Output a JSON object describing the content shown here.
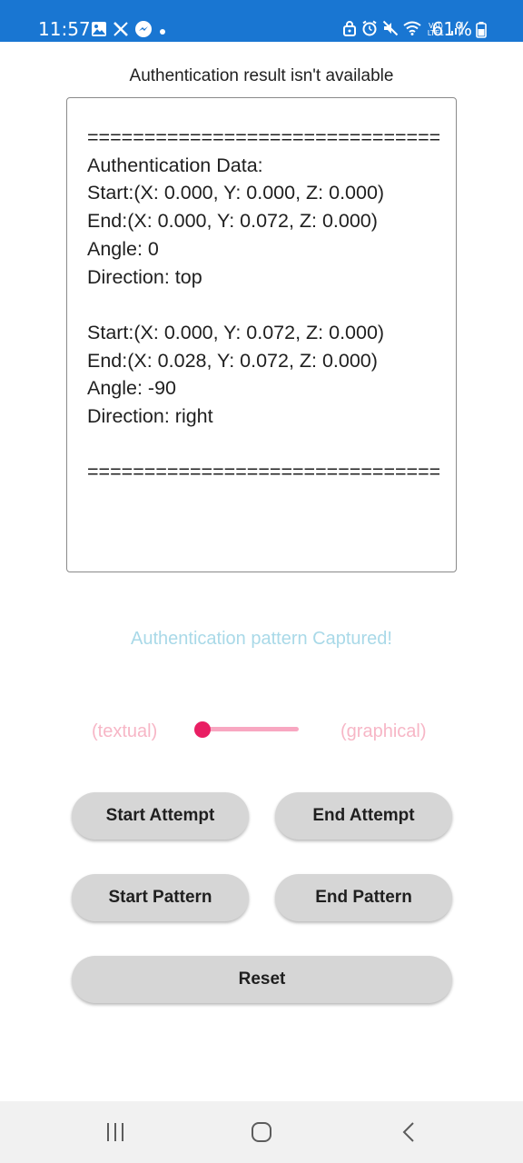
{
  "status_bar": {
    "time": "11:57",
    "left_icons": [
      "gallery-icon",
      "x-logo-icon",
      "messenger-icon",
      "dot-icon"
    ],
    "right_icons": [
      "lock-icon",
      "alarm-icon",
      "mute-icon",
      "wifi-icon",
      "volte-icon",
      "signal-icon"
    ],
    "volte_label": "Vo)) LTE1",
    "battery": "61%",
    "colors": {
      "background": "#1976d2",
      "foreground": "#ffffff"
    }
  },
  "header": {
    "result_title": "Authentication result isn't available"
  },
  "log": {
    "text": "================================\nAuthentication Data:\nStart:(X: 0.000, Y: 0.000, Z: 0.000)\nEnd:(X: 0.000, Y: 0.072, Z: 0.000)\nAngle: 0\nDirection: top\n\nStart:(X: 0.000, Y: 0.072, Z: 0.000)\nEnd:(X: 0.028, Y: 0.072, Z: 0.000)\nAngle: -90\nDirection: right\n\n================================"
  },
  "status_message": {
    "text": "Authentication pattern Captured!",
    "color": "#a9d9e8"
  },
  "mode_switch": {
    "left_label": "(textual)",
    "right_label": "(graphical)",
    "checked": false,
    "label_color": "#f7b6c6",
    "thumb_color": "#e91e63",
    "track_color": "#f8a7c1"
  },
  "buttons": {
    "start_attempt": "Start Attempt",
    "end_attempt": "End Attempt",
    "start_pattern": "Start Pattern",
    "end_pattern": "End Pattern",
    "reset": "Reset",
    "background": "#d6d6d6"
  },
  "nav_bar": {
    "items": [
      "recent-apps-icon",
      "home-icon",
      "back-icon"
    ]
  }
}
